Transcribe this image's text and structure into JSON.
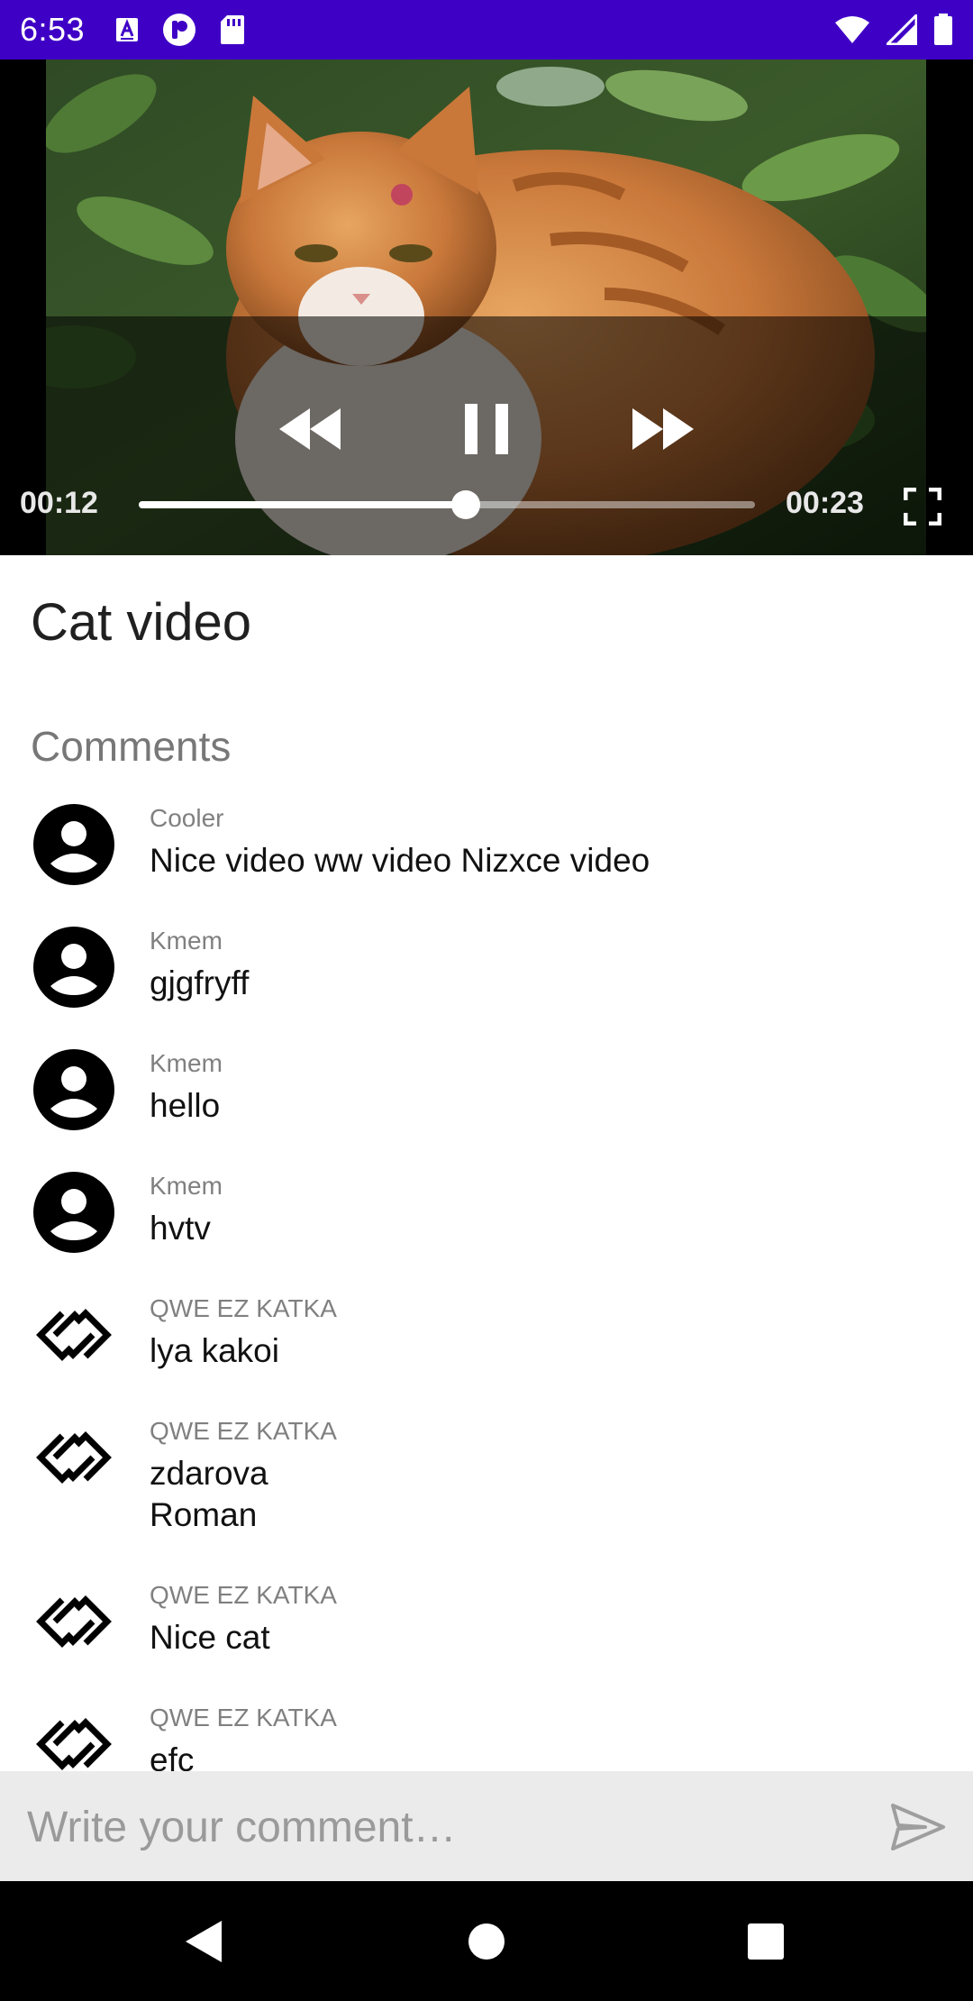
{
  "status_bar": {
    "time": "6:53",
    "left_icons": [
      "a-box-icon",
      "p-circle-icon",
      "sd-card-icon"
    ],
    "right_icons": [
      "wifi-icon",
      "signal-icon",
      "battery-icon"
    ],
    "background": "#3f00c6"
  },
  "player": {
    "current_time": "00:12",
    "duration": "00:23",
    "progress_fraction": 0.53,
    "controls": [
      "rewind-icon",
      "pause-icon",
      "fast-forward-icon",
      "fullscreen-icon"
    ]
  },
  "video": {
    "title": "Cat video"
  },
  "comments": {
    "header": "Comments",
    "items": [
      {
        "author": "Cooler",
        "text": "Nice video ww video Nizxce video",
        "avatar": "account-circle-icon"
      },
      {
        "author": "Kmem",
        "text": "gjgfryff",
        "avatar": "account-circle-icon"
      },
      {
        "author": "Kmem",
        "text": "hello",
        "avatar": "account-circle-icon"
      },
      {
        "author": "Kmem",
        "text": "hvtv",
        "avatar": "account-circle-icon"
      },
      {
        "author": "QWE EZ KATKA",
        "text": "lya kakoi",
        "avatar": "diamond-link-logo-icon"
      },
      {
        "author": "QWE EZ KATKA",
        "text": "zdarova\nRoman",
        "avatar": "diamond-link-logo-icon"
      },
      {
        "author": "QWE EZ KATKA",
        "text": "Nice cat",
        "avatar": "diamond-link-logo-icon"
      },
      {
        "author": "QWE EZ KATKA",
        "text": "efc",
        "avatar": "diamond-link-logo-icon"
      }
    ]
  },
  "composer": {
    "placeholder": "Write your comment…",
    "value": ""
  },
  "nav_bar": {
    "buttons": [
      "back-icon",
      "home-icon",
      "recents-icon"
    ]
  }
}
